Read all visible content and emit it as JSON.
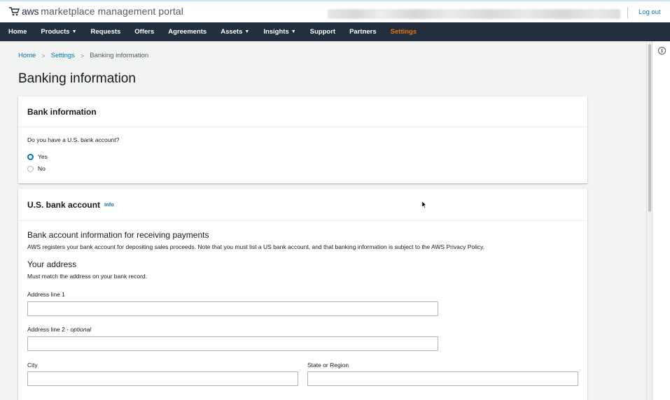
{
  "header": {
    "logo_brand": "aws",
    "logo_text": "marketplace management portal",
    "logout_label": "Log out"
  },
  "nav": {
    "items": [
      {
        "label": "Home",
        "dropdown": false,
        "active": false
      },
      {
        "label": "Products",
        "dropdown": true,
        "active": false
      },
      {
        "label": "Requests",
        "dropdown": false,
        "active": false
      },
      {
        "label": "Offers",
        "dropdown": false,
        "active": false
      },
      {
        "label": "Agreements",
        "dropdown": false,
        "active": false
      },
      {
        "label": "Assets",
        "dropdown": true,
        "active": false
      },
      {
        "label": "Insights",
        "dropdown": true,
        "active": false
      },
      {
        "label": "Support",
        "dropdown": false,
        "active": false
      },
      {
        "label": "Partners",
        "dropdown": false,
        "active": false
      },
      {
        "label": "Settings",
        "dropdown": false,
        "active": true
      }
    ],
    "caret_icon": "chevron-down-icon"
  },
  "breadcrumb": {
    "items": [
      "Home",
      "Settings",
      "Banking information"
    ],
    "separator_icon": "chevron-right-icon"
  },
  "page_title": "Banking information",
  "bank_information": {
    "title": "Bank information",
    "question": "Do you have a U.S. bank account?",
    "options": [
      {
        "label": "Yes",
        "selected": true
      },
      {
        "label": "No",
        "selected": false
      }
    ]
  },
  "us_bank_account": {
    "title": "U.S. bank account",
    "info_link": "Info",
    "section_title": "Bank account information for receiving payments",
    "section_desc": "AWS registers your bank account for depositing sales proceeds. Note that you must list a US bank account, and that banking information is subject to the AWS Privacy Policy.",
    "address_title": "Your address",
    "address_desc": "Must match the address on your bank record.",
    "fields": {
      "address1_label": "Address line 1",
      "address1_value": "",
      "address2_label": "Address line 2 - ",
      "address2_optional": "optional",
      "address2_value": "",
      "city_label": "City",
      "city_value": "",
      "state_label": "State or Region",
      "state_value": ""
    }
  },
  "colors": {
    "nav_bg": "#232f3e",
    "accent_orange": "#ec7211",
    "link_blue": "#0073bb",
    "radio_selected": "#0073bb"
  }
}
